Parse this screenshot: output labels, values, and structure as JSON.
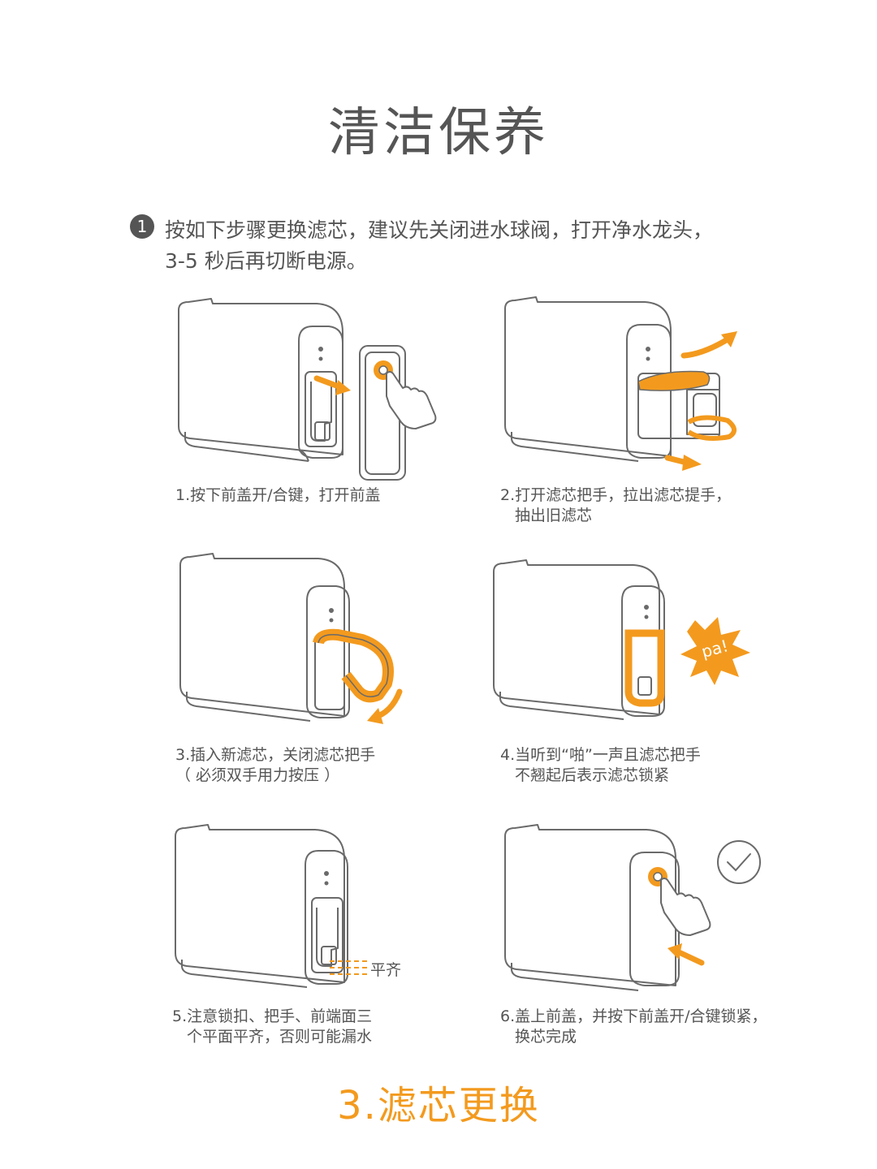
{
  "page": {
    "title": "清洁保养",
    "footer_title": "3.滤芯更换",
    "accent_color": "#f39a1e",
    "line_color": "#6a6a6a"
  },
  "intro": {
    "step_number": "1",
    "line1": "按如下步骤更换滤芯，建议先关闭进水球阀，打开净水龙头，",
    "line2": "3-5 秒后再切断电源。"
  },
  "steps": [
    {
      "line1": "1.按下前盖开/合键，打开前盖",
      "line2": ""
    },
    {
      "line1": "2.打开滤芯把手，拉出滤芯提手，",
      "line2": "抽出旧滤芯"
    },
    {
      "line1": "3.插入新滤芯，关闭滤芯把手",
      "line2": "（ 必须双手用力按压 ）"
    },
    {
      "line1": "4.当听到“啪”一声且滤芯把手",
      "line2": "不翘起后表示滤芯锁紧"
    },
    {
      "line1": "5.注意锁扣、把手、前端面三",
      "line2": "个平面平齐，否则可能漏水"
    },
    {
      "line1": "6.盖上前盖，并按下前盖开/合键锁紧，",
      "line2": "换芯完成"
    }
  ],
  "labels": {
    "align": "平齐",
    "pa": "pa!"
  },
  "icons": [
    "hand-press-icon",
    "curved-arrow-icon",
    "straight-arrow-icon",
    "burst-icon",
    "check-circle-icon"
  ]
}
